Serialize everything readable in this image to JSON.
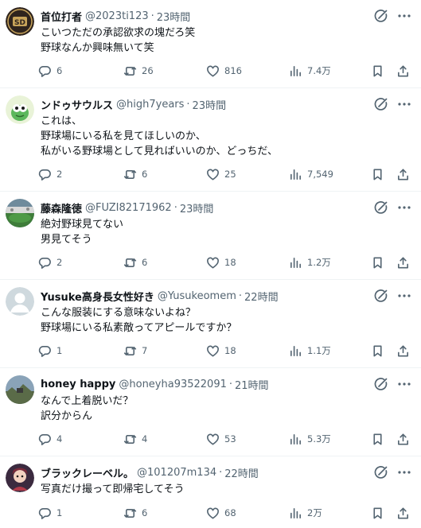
{
  "posts": [
    {
      "display_name": "首位打者",
      "handle": "@2023ti123",
      "time": "23時間",
      "lines": [
        "こいつただの承認欲求の塊だろ笑",
        "野球なんか興味無いて笑"
      ],
      "replies": "6",
      "reposts": "26",
      "likes": "816",
      "views": "7.4万",
      "avatar_icon": "padres-logo-avatar"
    },
    {
      "display_name": "ンドゥサウルス",
      "handle": "@high7years",
      "time": "23時間",
      "lines": [
        "これは、",
        "野球場にいる私を見てほしいのか、",
        "私がいる野球場として見ればいいのか、どっちだ、"
      ],
      "replies": "2",
      "reposts": "6",
      "likes": "25",
      "views": "7,549",
      "avatar_icon": "dinosaur-avatar"
    },
    {
      "display_name": "藤森隆徳",
      "handle": "@FUZI82171962",
      "time": "23時間",
      "lines": [
        "絶対野球見てない",
        "男見てそう"
      ],
      "replies": "2",
      "reposts": "6",
      "likes": "18",
      "views": "1.2万",
      "avatar_icon": "stadium-photo-avatar"
    },
    {
      "display_name": "Yusuke高身長女性好き",
      "handle": "@Yusukeomem",
      "time": "22時間",
      "lines": [
        "こんな服装にする意味ないよね？",
        "野球場にいる私素敵ってアピールですか？"
      ],
      "replies": "1",
      "reposts": "7",
      "likes": "18",
      "views": "1.1万",
      "avatar_icon": "default-person-avatar"
    },
    {
      "display_name": "honey happy",
      "handle": "@honeyha93522091",
      "time": "21時間",
      "lines": [
        "なんで上着脱いだ？",
        "訳分からん"
      ],
      "replies": "4",
      "reposts": "4",
      "likes": "53",
      "views": "5.3万",
      "avatar_icon": "landscape-photo-avatar"
    },
    {
      "display_name": "ブラックレーベル。",
      "handle": "@101207m134",
      "time": "22時間",
      "lines": [
        "写真だけ撮って即帰宅してそう"
      ],
      "replies": "1",
      "reposts": "6",
      "likes": "68",
      "views": "2万",
      "avatar_icon": "character-avatar"
    }
  ],
  "separator": "·",
  "colors": {
    "text": "#0f1419",
    "secondary": "#536471",
    "divider": "#eff3f4",
    "background": "#ffffff"
  }
}
